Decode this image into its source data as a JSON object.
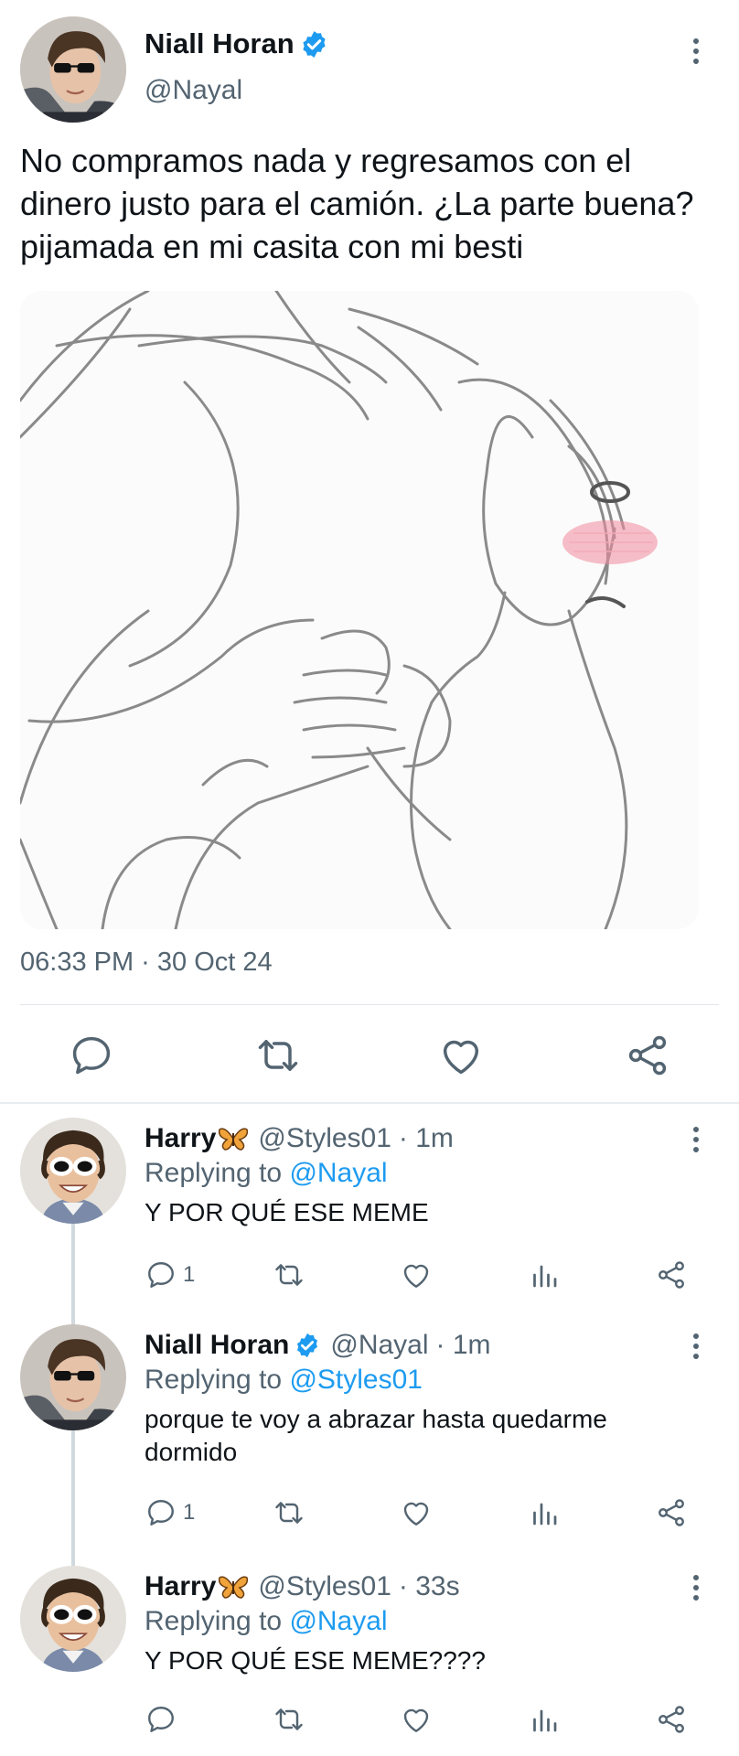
{
  "main_tweet": {
    "author_name": "Niall Horan",
    "author_handle": "@Nayal",
    "verified": true,
    "text": "No compramos nada y regresamos con el dinero justo para el camión. ¿La parte buena? pijamada en mi casita con mi besti",
    "timestamp": "06:33 PM · 30 Oct 24",
    "media": {
      "type": "sketch-image",
      "description_icon": "hug-sketch-image"
    },
    "actions": [
      "reply-icon",
      "retweet-icon",
      "like-icon",
      "share-icon"
    ]
  },
  "replies": [
    {
      "author_name": "Harry",
      "name_emoji": "butterfly-emoji",
      "author_handle": "@Styles01",
      "time": "· 1m",
      "replying_prefix": "Replying to ",
      "replying_to": "@Nayal",
      "text": "Y POR QUÉ ESE MEME",
      "reply_count": "1",
      "verified": false
    },
    {
      "author_name": "Niall Horan",
      "author_handle": "@Nayal",
      "time": "· 1m",
      "replying_prefix": "Replying to ",
      "replying_to": "@Styles01",
      "text": "porque te voy a abrazar hasta quedarme dormido",
      "reply_count": "1",
      "verified": true
    },
    {
      "author_name": "Harry",
      "name_emoji": "butterfly-emoji",
      "author_handle": "@Styles01",
      "time": "· 33s",
      "replying_prefix": "Replying to ",
      "replying_to": "@Nayal",
      "text": "Y POR QUÉ ESE MEME????",
      "reply_count": "",
      "verified": false
    }
  ],
  "colors": {
    "accent": "#1d9bf0",
    "secondary_text": "#536471",
    "primary_text": "#0f1419",
    "blush": "#f08a9c"
  }
}
